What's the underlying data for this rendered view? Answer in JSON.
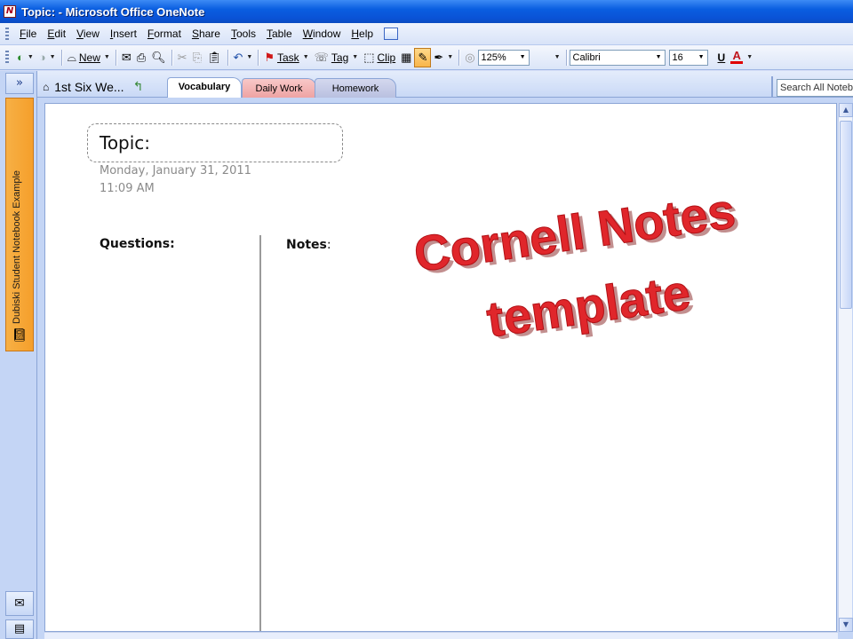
{
  "window": {
    "title": "Topic: - Microsoft Office OneNote",
    "app_icon": "onenote-icon"
  },
  "menu": [
    "File",
    "Edit",
    "View",
    "Insert",
    "Format",
    "Share",
    "Tools",
    "Table",
    "Window",
    "Help"
  ],
  "toolbar": {
    "new_label": "New",
    "task_label": "Task",
    "tag_label": "Tag",
    "clip_label": "Clip",
    "zoom": "125%",
    "font": "Calibri",
    "font_size": "16",
    "underline_label": "U",
    "font_color_label": "A",
    "font_color": "#e00000"
  },
  "navigation": {
    "expand_label": "»",
    "notebook_name": "Dubiski Student Notebook Example",
    "notebook_color": "#f59f2b"
  },
  "sections": {
    "current": "1st Six We...",
    "tabs": [
      {
        "label": "Vocabulary",
        "active": true
      },
      {
        "label": "Daily Work",
        "color": "#eea3a3"
      },
      {
        "label": "Homework",
        "color": "#b9c0e0"
      }
    ],
    "search_placeholder": "Search All Notebooks"
  },
  "page": {
    "title": "Topic:",
    "date": "Monday, January 31, 2011",
    "time": "11:09 AM",
    "questions_label": "Questions:",
    "notes_label": "Notes",
    "notes_colon": ":"
  },
  "overlay": {
    "line1": "Cornell Notes",
    "line2": "template",
    "color": "#e0262b"
  }
}
